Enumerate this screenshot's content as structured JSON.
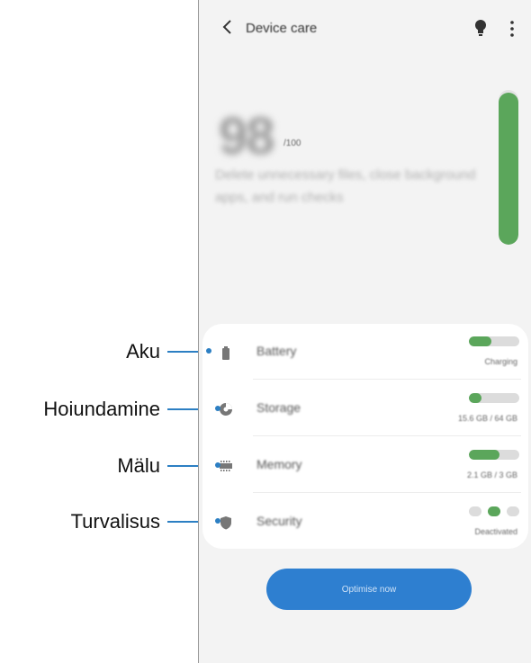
{
  "app": {
    "title": "Device care",
    "icons": {
      "back": "back-arrow-icon",
      "tip": "lightbulb-icon",
      "more": "more-options-icon"
    }
  },
  "score": {
    "value": "98",
    "max": "/100",
    "description": "Delete unnecessary files, close background apps, and run checks",
    "level_fraction": 0.98
  },
  "items": [
    {
      "label": "Battery",
      "value": "Charging",
      "level_fraction": 0.45,
      "icon": "battery-icon"
    },
    {
      "label": "Storage",
      "value": "15.6 GB / 64 GB",
      "level_fraction": 0.25,
      "icon": "storage-pie-icon"
    },
    {
      "label": "Memory",
      "value": "2.1 GB / 3 GB",
      "level_fraction": 0.6,
      "icon": "memory-chip-icon"
    },
    {
      "label": "Security",
      "value": "Deactivated",
      "icon": "shield-icon"
    }
  ],
  "optimise_button": "Optimise now",
  "callouts": {
    "battery": "Aku",
    "storage": "Hoiundamine",
    "memory": "Mälu",
    "security": "Turvalisus"
  },
  "colors": {
    "accent_green": "#5ba65b",
    "button_blue": "#2e7fd0",
    "callout_line": "#2c7fc3",
    "screen_bg": "#f3f3f3"
  }
}
